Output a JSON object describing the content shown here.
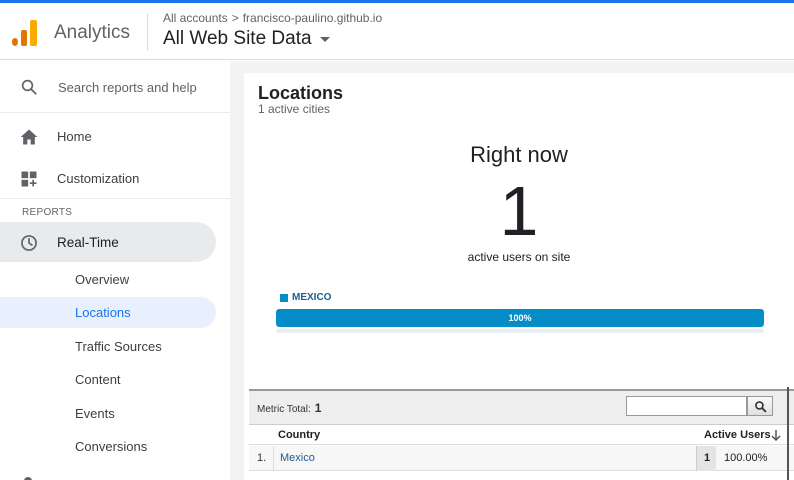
{
  "header": {
    "app_name": "Analytics",
    "breadcrumb": [
      "All accounts",
      "francisco-paulino.github.io"
    ],
    "breadcrumb_separator": ">",
    "view_name": "All Web Site Data"
  },
  "sidebar": {
    "search_placeholder": "Search reports and help",
    "home": "Home",
    "customization": "Customization",
    "section_label": "REPORTS",
    "realtime": "Real-Time",
    "sub_items": [
      "Overview",
      "Locations",
      "Traffic Sources",
      "Content",
      "Events",
      "Conversions"
    ],
    "active_sub_item": "Locations"
  },
  "main": {
    "title": "Locations",
    "subtitle": "1 active cities",
    "right_now_label": "Right now",
    "active_users": "1",
    "active_users_caption": "active users on site",
    "legend_label": "MEXICO",
    "bar_fraction": 1.0,
    "bar_label": "100%"
  },
  "table": {
    "metric_total_label": "Metric Total:",
    "metric_total_value": "1",
    "search_value": "",
    "columns": [
      "Country",
      "Active Users"
    ],
    "rows": [
      {
        "index": "1.",
        "country": "Mexico",
        "active_users": "1",
        "percent": "100.00%"
      }
    ]
  },
  "colors": {
    "accent": "#1a73e8",
    "bar": "#058dc7",
    "logo_orange": "#e37400",
    "logo_yellow": "#f9ab00"
  },
  "icons": [
    "search-icon",
    "home-icon",
    "customization-icon",
    "clock-icon",
    "chevron-down-icon",
    "sort-down-icon"
  ]
}
